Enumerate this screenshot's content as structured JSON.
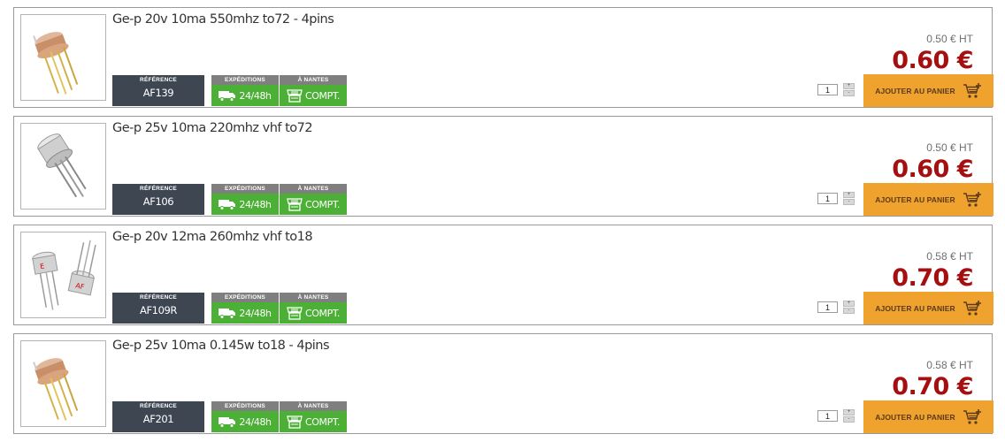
{
  "labels": {
    "reference": "RÉFÉRENCE",
    "shipping": "EXPÉDITIONS",
    "store": "À NANTES",
    "shipping_value": "24/48h",
    "store_value": "COMPT.",
    "add_to_cart": "AJOUTER AU PANIER"
  },
  "products": [
    {
      "title": "Ge-p 20v 10ma 550mhz to72 - 4pins",
      "reference": "AF139",
      "price_ht": "0.50 € HT",
      "price_ttc": "0.60 €",
      "quantity": "1"
    },
    {
      "title": "Ge-p 25v 10ma 220mhz vhf to72",
      "reference": "AF106",
      "price_ht": "0.50 € HT",
      "price_ttc": "0.60 €",
      "quantity": "1"
    },
    {
      "title": "Ge-p 20v 12ma 260mhz vhf to18",
      "reference": "AF109R",
      "price_ht": "0.58 € HT",
      "price_ttc": "0.70 €",
      "quantity": "1"
    },
    {
      "title": "Ge-p 25v 10ma 0.145w to18 - 4pins",
      "reference": "AF201",
      "price_ht": "0.58 € HT",
      "price_ttc": "0.70 €",
      "quantity": "1"
    }
  ],
  "icons": {
    "truck": "truck-icon",
    "store": "store-icon",
    "cart": "cart-plus-icon"
  },
  "colors": {
    "cart_button": "#f0a22e",
    "price": "#a50f0f",
    "badge_green": "#4bb035",
    "reference_bg": "#3e4652"
  }
}
